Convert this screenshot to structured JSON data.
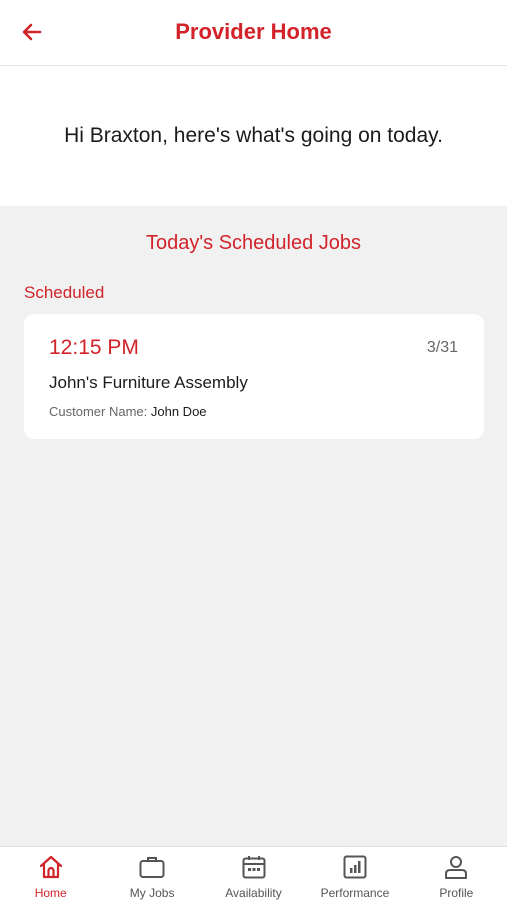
{
  "header": {
    "title": "Provider Home",
    "back_icon": "arrow-left-icon"
  },
  "greeting": {
    "text": "Hi Braxton, here's what's going on today."
  },
  "jobs": {
    "section_title": "Today's Scheduled Jobs",
    "status_label": "Scheduled",
    "items": [
      {
        "time": "12:15 PM",
        "date": "3/31",
        "name": "John's Furniture Assembly",
        "customer_label": "Customer Name:",
        "customer_name": "John Doe"
      }
    ]
  },
  "nav": {
    "active": "Home",
    "items": [
      {
        "label": "Home",
        "icon": "home-icon"
      },
      {
        "label": "My Jobs",
        "icon": "briefcase-icon"
      },
      {
        "label": "Availability",
        "icon": "calendar-icon"
      },
      {
        "label": "Performance",
        "icon": "bar-chart-icon"
      },
      {
        "label": "Profile",
        "icon": "user-icon"
      }
    ]
  },
  "colors": {
    "accent": "#d2232a",
    "background": "#f1f1f1",
    "card": "#ffffff",
    "nav_inactive": "#555555"
  }
}
